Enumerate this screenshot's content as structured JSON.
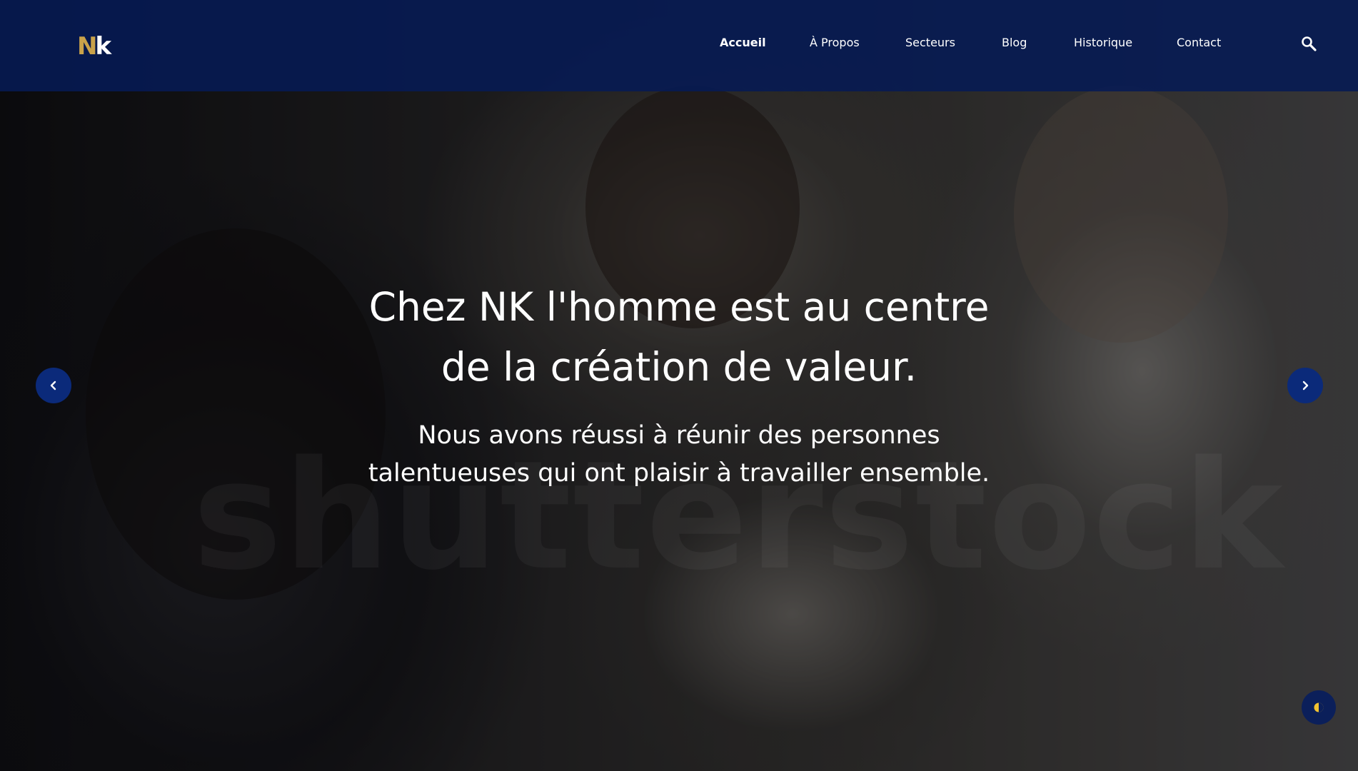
{
  "brand": {
    "logo_n": "N",
    "logo_k": "k",
    "accent_color": "#c9a24a",
    "nav_bg": "#061a54"
  },
  "nav": {
    "items": [
      {
        "label": "Accueil",
        "active": true
      },
      {
        "label": "À Propos",
        "active": false
      },
      {
        "label": "Secteurs",
        "active": false
      },
      {
        "label": "Blog",
        "active": false
      },
      {
        "label": "Historique",
        "active": false
      },
      {
        "label": "Contact",
        "active": false
      }
    ],
    "search_icon": "search-icon"
  },
  "hero": {
    "headline_line1": "Chez NK l'homme est au centre",
    "headline_line2": "de la création de valeur.",
    "subline_line1": "Nous avons réussi à réunir des personnes",
    "subline_line2": "talentueuses qui ont plaisir à travailler ensemble.",
    "watermark": "shutterstock"
  },
  "controls": {
    "prev_icon": "chevron-left-icon",
    "next_icon": "chevron-right-icon",
    "theme_icon": "half-circle-icon"
  }
}
